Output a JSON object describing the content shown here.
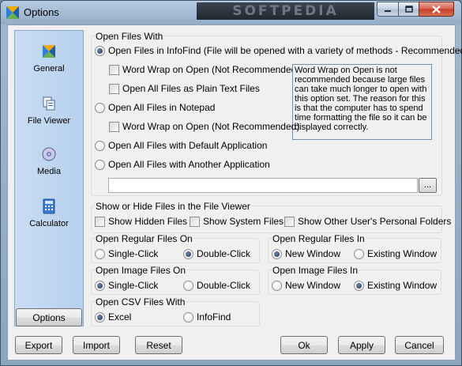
{
  "window": {
    "title": "Options",
    "watermark": "SOFTPEDIA"
  },
  "nav": {
    "items": [
      {
        "label": "General",
        "icon": "general-icon"
      },
      {
        "label": "File Viewer",
        "icon": "file-viewer-icon"
      },
      {
        "label": "Media",
        "icon": "media-icon"
      },
      {
        "label": "Calculator",
        "icon": "calculator-icon"
      }
    ],
    "options_label": "Options"
  },
  "open_files": {
    "title": "Open Files With",
    "infofind": "Open Files in InfoFind (File will be opened with a variety of methods - Recommended)",
    "word_wrap_1": "Word Wrap on Open (Not Recommended)",
    "plain_text": "Open All Files as Plain Text Files",
    "notepad": "Open All Files in Notepad",
    "word_wrap_2": "Word Wrap on Open (Not Recommended)",
    "default_app": "Open All Files with Default Application",
    "another_app": "Open All Files with Another Application",
    "info_text": "Word Wrap on Open is not recommended because large files can take much longer to open with this option set. The reason for this is that the computer has to spend time formatting the file so it can be displayed correctly.",
    "path_value": "",
    "browse_label": "..."
  },
  "show_hide": {
    "title": "Show or Hide Files in the File Viewer",
    "hidden": "Show Hidden Files",
    "system": "Show System Files",
    "other_users": "Show Other User's Personal Folders"
  },
  "regular_on": {
    "title": "Open Regular Files On",
    "single": "Single-Click",
    "double": "Double-Click"
  },
  "regular_in": {
    "title": "Open Regular Files In",
    "new": "New Window",
    "existing": "Existing Window"
  },
  "image_on": {
    "title": "Open Image Files On",
    "single": "Single-Click",
    "double": "Double-Click"
  },
  "image_in": {
    "title": "Open Image Files In",
    "new": "New Window",
    "existing": "Existing Window"
  },
  "csv": {
    "title": "Open CSV Files With",
    "excel": "Excel",
    "infofind": "InfoFind"
  },
  "buttons": {
    "export": "Export",
    "import": "Import",
    "reset": "Reset",
    "ok": "Ok",
    "apply": "Apply",
    "cancel": "Cancel"
  }
}
